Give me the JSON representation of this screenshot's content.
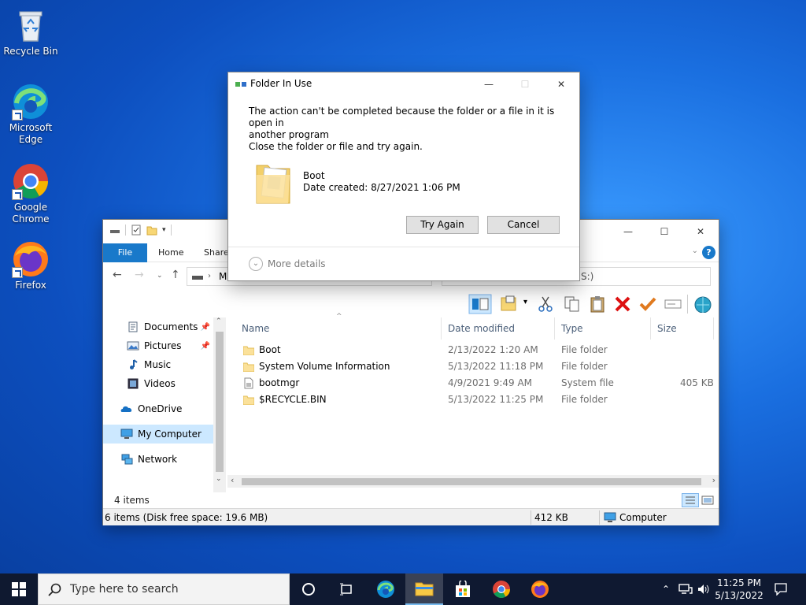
{
  "desktop": {
    "icons": [
      {
        "label": "Recycle Bin",
        "icon": "recycle-bin-icon"
      },
      {
        "label": "Microsoft Edge",
        "icon": "edge-icon"
      },
      {
        "label": "Google Chrome",
        "icon": "chrome-icon"
      },
      {
        "label": "Firefox",
        "icon": "firefox-icon"
      }
    ]
  },
  "explorer": {
    "ribbon_tabs": [
      "File",
      "Home",
      "Share"
    ],
    "address_text": "M",
    "search_text": "S:)",
    "nav": [
      {
        "label": "Documents",
        "icon": "documents-icon",
        "pinned": true
      },
      {
        "label": "Pictures",
        "icon": "pictures-icon",
        "pinned": true
      },
      {
        "label": "Music",
        "icon": "music-icon",
        "pinned": false
      },
      {
        "label": "Videos",
        "icon": "videos-icon",
        "pinned": false
      },
      {
        "label": "OneDrive",
        "icon": "onedrive-icon",
        "pinned": false
      },
      {
        "label": "My Computer",
        "icon": "computer-icon",
        "pinned": false,
        "selected": true
      },
      {
        "label": "Network",
        "icon": "network-icon",
        "pinned": false
      }
    ],
    "columns": {
      "name": "Name",
      "date": "Date modified",
      "type": "Type",
      "size": "Size"
    },
    "files": [
      {
        "name": "Boot",
        "date": "2/13/2022 1:20 AM",
        "type": "File folder",
        "size": "",
        "icon": "folder-icon"
      },
      {
        "name": "System Volume Information",
        "date": "5/13/2022 11:18 PM",
        "type": "File folder",
        "size": "",
        "icon": "folder-icon"
      },
      {
        "name": "bootmgr",
        "date": "4/9/2021 9:49 AM",
        "type": "System file",
        "size": "405 KB",
        "icon": "file-icon"
      },
      {
        "name": "$RECYCLE.BIN",
        "date": "5/13/2022 11:25 PM",
        "type": "File folder",
        "size": "",
        "icon": "folder-icon"
      }
    ],
    "item_count": "4 items",
    "status": {
      "left": "6 items (Disk free space: 19.6 MB)",
      "size": "412 KB",
      "location": "Computer"
    }
  },
  "dialog": {
    "title": "Folder In Use",
    "message_line1": "The action can't be completed because the folder or a file in it is open in",
    "message_line2": "another program",
    "instruction": "Close the folder or file and try again.",
    "file_name": "Boot",
    "date_created": "Date created: 8/27/2021 1:06 PM",
    "try_again": "Try Again",
    "cancel": "Cancel",
    "more_details": "More details"
  },
  "taskbar": {
    "search_placeholder": "Type here to search",
    "time": "11:25 PM",
    "date": "5/13/2022"
  },
  "colors": {
    "accent": "#1979ca",
    "selection": "#cce8ff",
    "taskbar": "#10182c"
  }
}
